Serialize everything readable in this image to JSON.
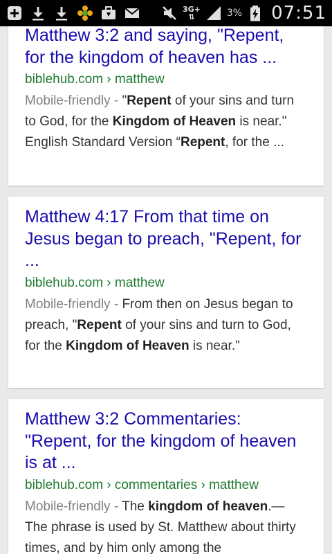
{
  "status_bar": {
    "icons_left": [
      "add-icon",
      "download-icon",
      "download-icon",
      "flower-icon",
      "briefcase-icon",
      "mail-icon"
    ],
    "network": "3G+",
    "battery_percent": "3%",
    "time": "07:51"
  },
  "results": [
    {
      "title": "Matthew 3:2 and saying, \"Repent, for the kingdom of heaven has ...",
      "url": "biblehub.com › matthew",
      "mobile_friendly": "Mobile-friendly - ",
      "snippet": [
        {
          "t": "\"",
          "b": false
        },
        {
          "t": "Repent",
          "b": true
        },
        {
          "t": " of your sins and turn to God, for the ",
          "b": false
        },
        {
          "t": "Kingdom of Heaven",
          "b": true
        },
        {
          "t": " is near.\" English Standard Version “",
          "b": false
        },
        {
          "t": "Repent",
          "b": true
        },
        {
          "t": ", for the ...",
          "b": false
        }
      ]
    },
    {
      "title": "Matthew 4:17 From that time on Jesus began to preach, \"Repent, for ...",
      "url": "biblehub.com › matthew",
      "mobile_friendly": "Mobile-friendly - ",
      "snippet": [
        {
          "t": "From then on Jesus began to preach, \"",
          "b": false
        },
        {
          "t": "Repent",
          "b": true
        },
        {
          "t": " of your sins and turn to God, for the ",
          "b": false
        },
        {
          "t": "Kingdom of Heaven",
          "b": true
        },
        {
          "t": " is near.\"",
          "b": false
        }
      ]
    },
    {
      "title": "Matthew 3:2 Commentaries: \"Repent, for the kingdom of heaven is at ...",
      "url": "biblehub.com › commentaries › matthew",
      "mobile_friendly": "Mobile-friendly - ",
      "snippet": [
        {
          "t": "The ",
          "b": false
        },
        {
          "t": "kingdom of heaven",
          "b": true
        },
        {
          "t": ".—The phrase is used by St. Matthew about thirty times, and by him only among the",
          "b": false
        }
      ]
    }
  ]
}
